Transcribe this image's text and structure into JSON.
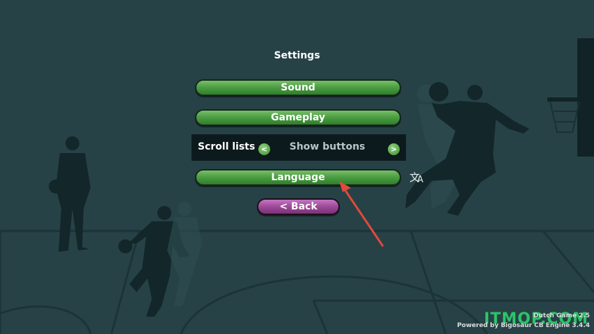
{
  "screen": {
    "title": "Settings"
  },
  "menu": {
    "sound_label": "Sound",
    "gameplay_label": "Gameplay",
    "scroll_lists": {
      "label": "Scroll lists",
      "prev_label": "<",
      "value": "Show buttons",
      "next_label": ">"
    },
    "language_label": "Language",
    "back_label": "< Back"
  },
  "language_icon": "translate-icon",
  "footer": {
    "version": "Dutch Game 2.5",
    "engine": "Powered by Bigosaur CB Engine 3.4.4"
  },
  "watermark": "ITMOP.COM",
  "colors": {
    "background": "#264246",
    "button_green": "#4e9e45",
    "button_purple": "#9d4a98",
    "annotation_arrow": "#e04a3c"
  }
}
